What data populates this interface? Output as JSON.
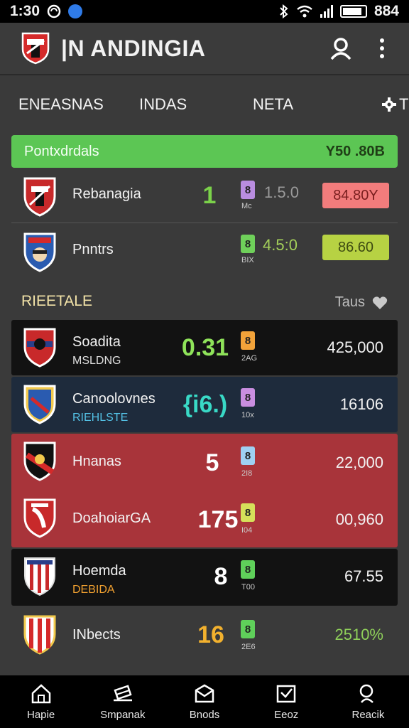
{
  "status": {
    "time": "1:30",
    "battery": "884"
  },
  "app": {
    "title": "|N ANDINGIA"
  },
  "tabs": [
    {
      "label": "ENEASNAS"
    },
    {
      "label": "INDAS"
    },
    {
      "label": "NETA"
    },
    {
      "label": "TN"
    }
  ],
  "top_section": {
    "title": "Pontxdrdals",
    "value": "Y50 .80B",
    "rows": [
      {
        "team": "Rebanagia",
        "score": "1",
        "badge": "8",
        "badge_sub": "Mc",
        "odd1": "1.5.0",
        "odd2": "84.80Y",
        "box_color": "#f27c7c",
        "badge_color": "#b98de0",
        "score_color": "#7bd24a"
      },
      {
        "team": "Pnntrs",
        "score": "",
        "badge": "8",
        "badge_sub": "BIX",
        "odd1": "4.5:0",
        "odd2": "86.60",
        "box_color": "#b7d243",
        "badge_color": "#6fd05a",
        "score_color": "#7bd24a"
      }
    ]
  },
  "section2": {
    "title": "RIEETALE",
    "right_label": "Taus"
  },
  "list": [
    {
      "team": "Soadita",
      "sub": "MSLDNG",
      "score": "0.31",
      "badge": "8",
      "badge_sub": "2AG",
      "value": "425,000",
      "score_color": "#8fe35a",
      "badge_color": "#f2a33a",
      "sub_color": "#e0e0e0"
    },
    {
      "team": "Canoolovnes",
      "sub": "RIEHLSTE",
      "score": "{i6.)",
      "badge": "8",
      "badge_sub": "10x",
      "value": "16106",
      "score_color": "#39d9c6",
      "badge_color": "#c98ee0",
      "sub_color": "#54c2e6"
    },
    {
      "team": "Hnanas",
      "sub": "",
      "score": "5",
      "badge": "8",
      "badge_sub": "2I8",
      "value": "22,000",
      "score_color": "#ffffff",
      "badge_color": "#9fd0f2",
      "sub_color": "#e0e0e0"
    },
    {
      "team": "DoahoiarGA",
      "sub": "",
      "score": "175",
      "badge": "8",
      "badge_sub": "I04",
      "value": "00,960",
      "score_color": "#ffffff",
      "badge_color": "#d6e05a",
      "sub_color": "#e0e0e0"
    },
    {
      "team": "Hoemda",
      "sub": "DEBIDA",
      "score": "8",
      "badge": "8",
      "badge_sub": "T00",
      "value": "67.55",
      "score_color": "#ffffff",
      "badge_color": "#5fd05a",
      "sub_color": "#f0a030"
    },
    {
      "team": "INbects",
      "sub": "",
      "score": "16",
      "badge": "8",
      "badge_sub": "2E6",
      "value": "2510%",
      "score_color": "#f2b12e",
      "badge_color": "#5fd05a",
      "sub_color": "#e0e0e0"
    }
  ],
  "nav": [
    {
      "label": "Hapie",
      "icon": "home-icon"
    },
    {
      "label": "Smpanak",
      "icon": "ticket-icon"
    },
    {
      "label": "Bnods",
      "icon": "mail-icon"
    },
    {
      "label": "Eeoz",
      "icon": "check-box-icon"
    },
    {
      "label": "Reacik",
      "icon": "search-icon"
    }
  ]
}
